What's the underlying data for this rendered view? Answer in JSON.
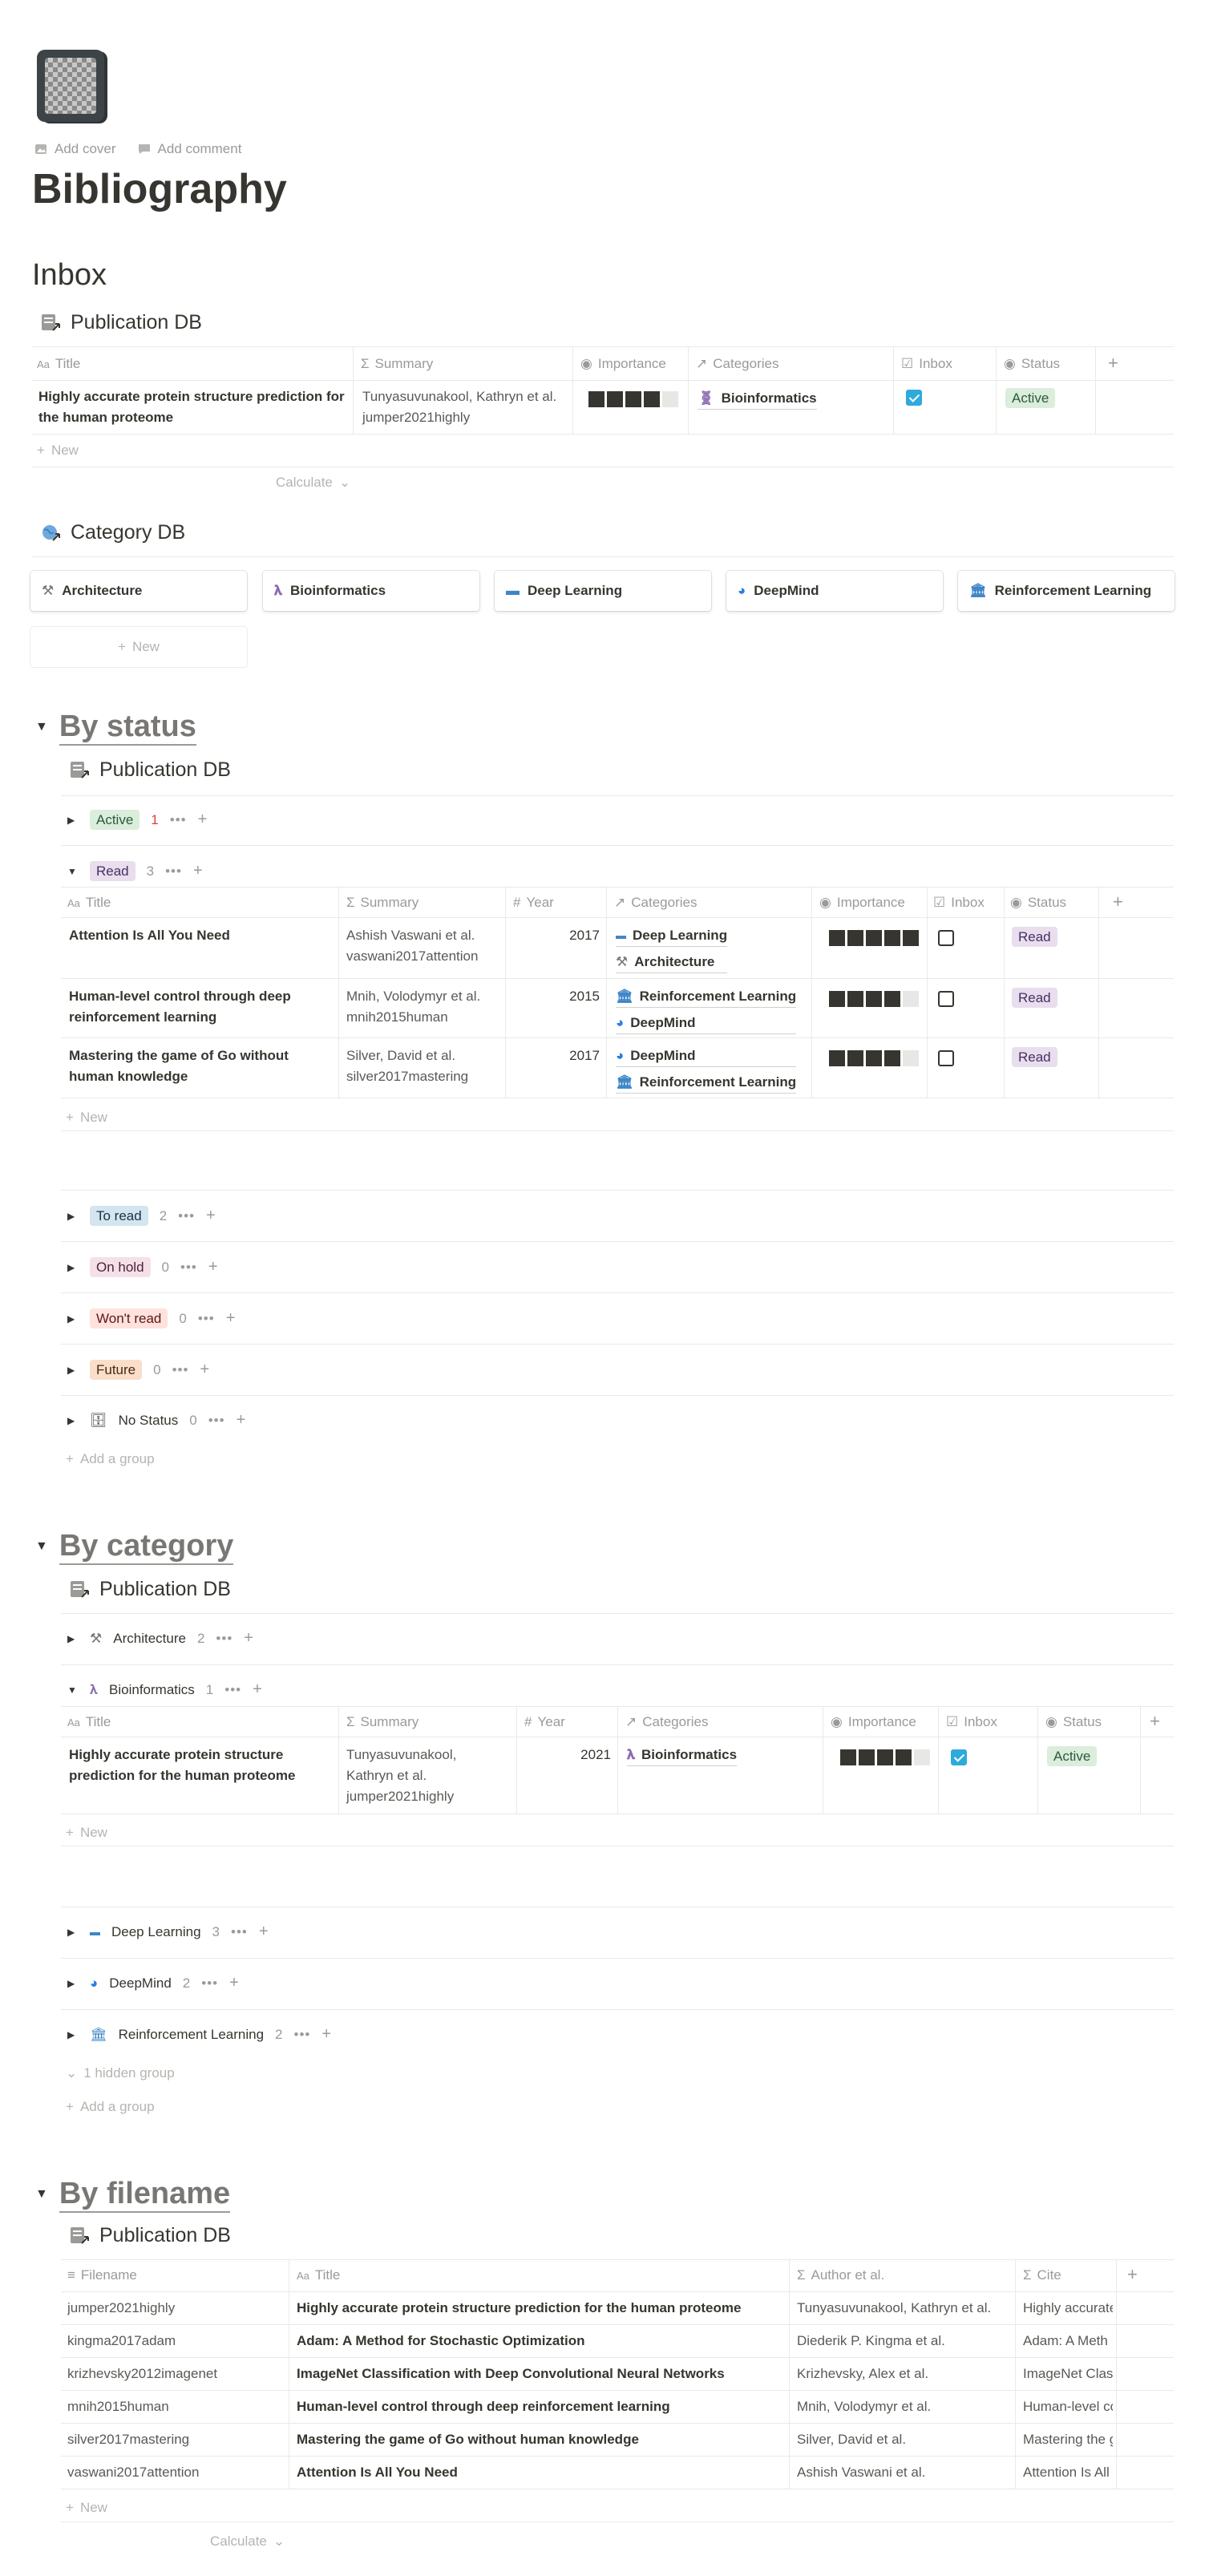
{
  "page": {
    "title": "Bibliography",
    "add_cover": "Add cover",
    "add_comment": "Add comment"
  },
  "inbox": {
    "heading": "Inbox",
    "db_title": "Publication DB",
    "columns": [
      "Title",
      "Summary",
      "Importance",
      "Categories",
      "Inbox",
      "Status"
    ],
    "rows": [
      {
        "title_1": "Highly accurate protein structure prediction for",
        "title_2": "the human proteome",
        "summary_1": "Tunyasuvunakool, Kathryn et al.",
        "summary_2": "jumper2021highly",
        "importance": 4,
        "category": "Bioinformatics",
        "inbox": true,
        "status": "Active"
      }
    ],
    "new_label": "New",
    "calculate_label": "Calculate"
  },
  "category_db": {
    "title": "Category DB",
    "cards": [
      {
        "label": "Architecture",
        "icon": "architecture-icon"
      },
      {
        "label": "Bioinformatics",
        "icon": "dna-icon"
      },
      {
        "label": "Deep Learning",
        "icon": "laptop-icon"
      },
      {
        "label": "DeepMind",
        "icon": "deepmind-icon"
      },
      {
        "label": "Reinforcement Learning",
        "icon": "bank-icon"
      }
    ],
    "new_label": "New"
  },
  "by_status": {
    "heading": "By status",
    "db_title": "Publication DB",
    "groups_top": [
      {
        "label": "Active",
        "count": "1"
      }
    ],
    "read_group": {
      "label": "Read",
      "count": "3"
    },
    "columns": [
      "Title",
      "Summary",
      "Year",
      "Categories",
      "Importance",
      "Inbox",
      "Status"
    ],
    "rows": [
      {
        "title_1": "Attention Is All You Need",
        "title_2": "",
        "summary_1": "Ashish Vaswani et al.",
        "summary_2": "vaswani2017attention",
        "year": "2017",
        "cat_1": "Deep Learning",
        "cat_2": "Architecture",
        "importance": 5,
        "inbox": false,
        "status": "Read"
      },
      {
        "title_1": "Human-level control through deep",
        "title_2": "reinforcement learning",
        "summary_1": "Mnih, Volodymyr et al.",
        "summary_2": "mnih2015human",
        "year": "2015",
        "cat_1": "Reinforcement Learning",
        "cat_2": "DeepMind",
        "importance": 4,
        "inbox": false,
        "status": "Read"
      },
      {
        "title_1": "Mastering the game of Go without",
        "title_2": "human knowledge",
        "summary_1": "Silver, David et al.",
        "summary_2": "silver2017mastering",
        "year": "2017",
        "cat_1": "DeepMind",
        "cat_2": "Reinforcement Learning",
        "importance": 4,
        "inbox": false,
        "status": "Read"
      }
    ],
    "new_label": "New",
    "groups_bottom": [
      {
        "label": "To read",
        "count": "2"
      },
      {
        "label": "On hold",
        "count": "0"
      },
      {
        "label": "Won't read",
        "count": "0"
      },
      {
        "label": "Future",
        "count": "0"
      },
      {
        "label": "No Status",
        "count": "0"
      }
    ],
    "add_group": "Add a group"
  },
  "by_category": {
    "heading": "By category",
    "db_title": "Publication DB",
    "architecture": {
      "label": "Architecture",
      "count": "2"
    },
    "bioinformatics": {
      "label": "Bioinformatics",
      "count": "1"
    },
    "columns": [
      "Title",
      "Summary",
      "Year",
      "Categories",
      "Importance",
      "Inbox",
      "Status"
    ],
    "row": {
      "title_1": "Highly accurate protein structure",
      "title_2": "prediction for the human proteome",
      "summary_1": "Tunyasuvunakool,",
      "summary_2": "Kathryn et al.",
      "summary_3": "jumper2021highly",
      "year": "2021",
      "category": "Bioinformatics",
      "importance": 4,
      "inbox": true,
      "status": "Active"
    },
    "new_label": "New",
    "groups_bottom": [
      {
        "label": "Deep Learning",
        "count": "3"
      },
      {
        "label": "DeepMind",
        "count": "2"
      },
      {
        "label": "Reinforcement Learning",
        "count": "2"
      }
    ],
    "hidden_groups": "1 hidden group",
    "add_group": "Add a group"
  },
  "by_filename": {
    "heading": "By filename",
    "db_title": "Publication DB",
    "columns": [
      "Filename",
      "Title",
      "Author et al.",
      "Cite"
    ],
    "rows": [
      {
        "filename": "jumper2021highly",
        "title": "Highly accurate protein structure prediction for the human proteome",
        "author": "Tunyasuvunakool, Kathryn et al.",
        "cite": "Highly accurate"
      },
      {
        "filename": "kingma2017adam",
        "title": "Adam: A Method for Stochastic Optimization",
        "author": "Diederik P. Kingma et al.",
        "cite": "Adam: A Meth"
      },
      {
        "filename": "krizhevsky2012imagenet",
        "title": "ImageNet Classification with Deep Convolutional Neural Networks",
        "author": "Krizhevsky, Alex et al.",
        "cite": "ImageNet Clas"
      },
      {
        "filename": "mnih2015human",
        "title": "Human-level control through deep reinforcement learning",
        "author": "Mnih, Volodymyr et al.",
        "cite": "Human-level co"
      },
      {
        "filename": "silver2017mastering",
        "title": "Mastering the game of Go without human knowledge",
        "author": "Silver, David et al.",
        "cite": "Mastering the g"
      },
      {
        "filename": "vaswani2017attention",
        "title": "Attention Is All You Need",
        "author": "Ashish Vaswani et al.",
        "cite": "Attention Is All"
      }
    ],
    "new_label": "New",
    "calculate_label": "Calculate"
  },
  "colors": {
    "text": "#37352f",
    "muted": "#9b9a97",
    "checkbox_blue": "#2eaadc",
    "active_tag": "#dbeddb",
    "read_tag": "#e8deee"
  }
}
